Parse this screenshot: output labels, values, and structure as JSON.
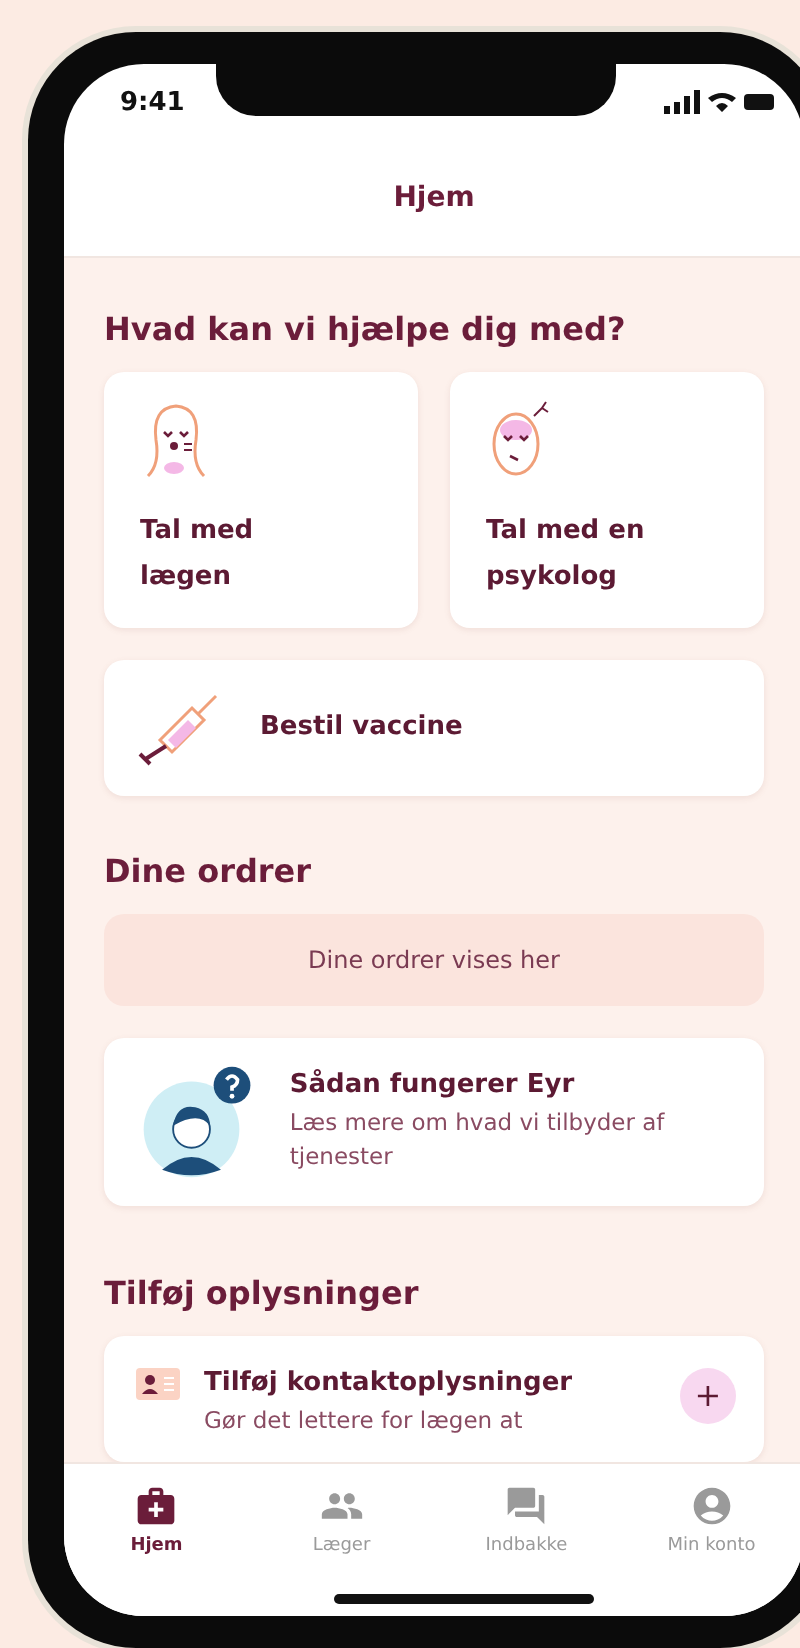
{
  "status_bar": {
    "time": "9:41"
  },
  "header": {
    "title": "Hjem"
  },
  "help": {
    "heading": "Hvad kan vi hjælpe dig med?",
    "services": [
      {
        "kind": "doctor",
        "label": "Tal med lægen"
      },
      {
        "kind": "psychologist",
        "label": "Tal med en psykolog"
      }
    ],
    "vaccine": {
      "label": "Bestil vaccine"
    }
  },
  "orders": {
    "heading": "Dine ordrer",
    "empty_text": "Dine ordrer vises her"
  },
  "info_card": {
    "title": "Sådan fungerer Eyr",
    "text": "Læs mere om hvad vi tilbyder af tjenester"
  },
  "add_info": {
    "heading": "Tilføj oplysninger",
    "items": [
      {
        "title": "Tilføj kontaktoplysninger",
        "text": "Gør det lettere for lægen at",
        "action": "+"
      }
    ]
  },
  "tabs": [
    {
      "kind": "home",
      "label": "Hjem",
      "selected": true
    },
    {
      "kind": "doctors",
      "label": "Læger",
      "selected": false
    },
    {
      "kind": "inbox",
      "label": "Indbakke",
      "selected": false
    },
    {
      "kind": "account",
      "label": "Min konto",
      "selected": false
    }
  ]
}
